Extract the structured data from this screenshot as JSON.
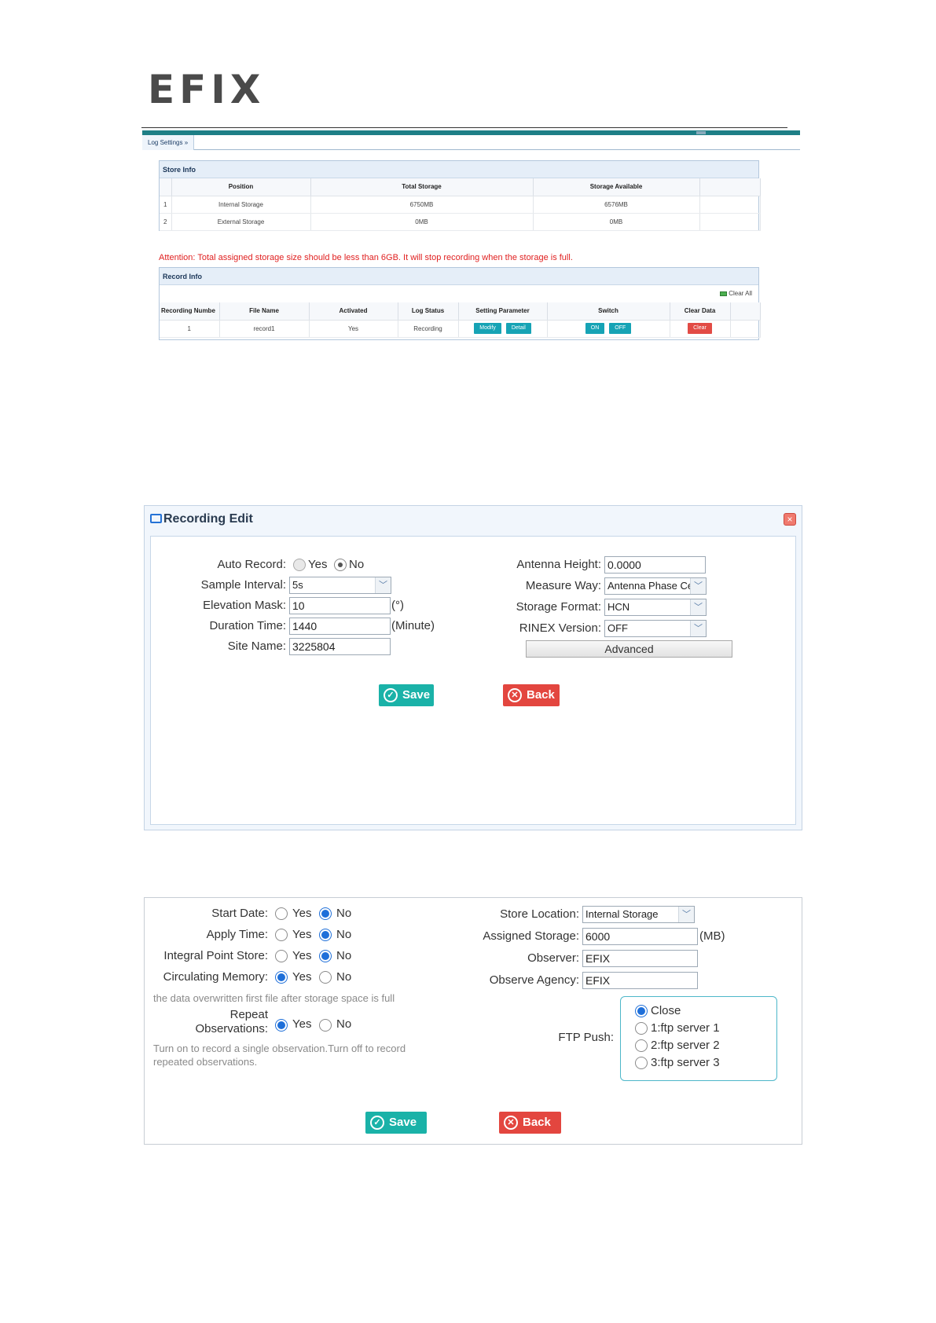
{
  "logo": {
    "text": "EFIX"
  },
  "log_settings": {
    "breadcrumb": "Log Settings »",
    "store_info": {
      "title": "Store Info",
      "columns": [
        "",
        "Position",
        "Total Storage",
        "Storage Available"
      ],
      "rows": [
        [
          "1",
          "Internal Storage",
          "6750MB",
          "6576MB"
        ],
        [
          "2",
          "External Storage",
          "0MB",
          "0MB"
        ]
      ]
    },
    "attention": "Attention: Total assigned storage size should be less than 6GB. It will stop recording when the storage is full.",
    "record_info": {
      "title": "Record Info",
      "clear_all": "Clear All",
      "columns": [
        "Recording Numbe",
        "File Name",
        "Activated",
        "Log Status",
        "Setting Parameter",
        "Switch",
        "Clear Data"
      ],
      "row": {
        "number": "1",
        "file_name": "record1",
        "activated": "Yes",
        "log_status": "Recording",
        "modify": "Modify",
        "detail": "Detail",
        "on": "ON",
        "off": "OFF",
        "clear": "Clear"
      }
    }
  },
  "recording_edit": {
    "title": "Recording Edit",
    "close": "×",
    "auto_record": {
      "label": "Auto Record:",
      "yes": "Yes",
      "no": "No",
      "selected": "No"
    },
    "sample_interval": {
      "label": "Sample Interval:",
      "value": "5s"
    },
    "elevation_mask": {
      "label": "Elevation Mask:",
      "value": "10",
      "unit": "(°)"
    },
    "duration_time": {
      "label": "Duration Time:",
      "value": "1440",
      "unit": "(Minute)"
    },
    "site_name": {
      "label": "Site Name:",
      "value": "3225804"
    },
    "antenna_height": {
      "label": "Antenna Height:",
      "value": "0.0000"
    },
    "measure_way": {
      "label": "Measure Way:",
      "value": "Antenna Phase Ce"
    },
    "storage_format": {
      "label": "Storage Format:",
      "value": "HCN"
    },
    "rinex_version": {
      "label": "RINEX Version:",
      "value": "OFF"
    },
    "advanced": "Advanced",
    "save": "Save",
    "back": "Back"
  },
  "advanced_settings": {
    "start_date": {
      "label": "Start Date:",
      "yes": "Yes",
      "no": "No",
      "selected": "No"
    },
    "apply_time": {
      "label": "Apply Time:",
      "yes": "Yes",
      "no": "No",
      "selected": "No"
    },
    "integral_point_store": {
      "label": "Integral Point Store:",
      "yes": "Yes",
      "no": "No",
      "selected": "No"
    },
    "circulating_memory": {
      "label": "Circulating Memory:",
      "yes": "Yes",
      "no": "No",
      "selected": "Yes",
      "note": "the data overwritten first file after storage space is full"
    },
    "repeat_observations": {
      "label_line1": "Repeat",
      "label_line2": "Observations:",
      "yes": "Yes",
      "no": "No",
      "selected": "Yes",
      "note_line1": "Turn on to record a single observation.Turn off to record",
      "note_line2": "repeated observations."
    },
    "store_location": {
      "label": "Store Location:",
      "value": "Internal Storage"
    },
    "assigned_storage": {
      "label": "Assigned Storage:",
      "value": "6000",
      "unit": "(MB)"
    },
    "observer": {
      "label": "Observer:",
      "value": "EFIX"
    },
    "observe_agency": {
      "label": "Observe Agency:",
      "value": "EFIX"
    },
    "ftp_push": {
      "label": "FTP Push:",
      "options": [
        "Close",
        "1:ftp server 1",
        "2:ftp server 2",
        "3:ftp server 3"
      ],
      "selected": "Close"
    },
    "save": "Save",
    "back": "Back"
  },
  "colors": {
    "accent": "#1ab2a8",
    "danger": "#e3463f",
    "header_bar": "#1e7f86",
    "attention": "#e02020",
    "radio_selected": "#1e6fd9"
  }
}
